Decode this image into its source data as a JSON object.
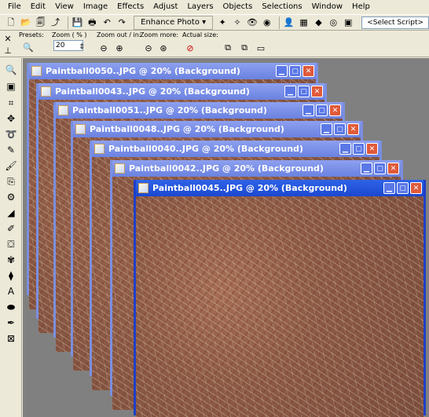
{
  "menubar": {
    "items": [
      "File",
      "Edit",
      "View",
      "Image",
      "Effects",
      "Adjust",
      "Layers",
      "Objects",
      "Selections",
      "Window",
      "Help"
    ]
  },
  "toolbar": {
    "enhance_photo_label": "Enhance Photo ▾",
    "script_select": "<Select Script>"
  },
  "tool_options": {
    "presets_label": "Presets:",
    "zoom_label": "Zoom ( % )",
    "zoom_value": "20",
    "zoom_out_in_label": "Zoom out / in:",
    "zoom_more_label": "Zoom more:",
    "actual_size_label": "Actual size:"
  },
  "documents": [
    {
      "title": "Paintball0050..JPG @  20% (Background)"
    },
    {
      "title": "Paintball0043..JPG @  20% (Background)"
    },
    {
      "title": "Paintball0051..JPG @  20% (Background)"
    },
    {
      "title": "Paintball0048..JPG @  20% (Background)"
    },
    {
      "title": "Paintball0040..JPG @  20% (Background)"
    },
    {
      "title": "Paintball0042..JPG @  20% (Background)"
    },
    {
      "title": "Paintball0045..JPG @  20% (Background)"
    }
  ],
  "active_document_index": 6,
  "colors": {
    "active_title": "#1b48d0",
    "inactive_title": "#7b8fe0",
    "workspace": "#808080"
  }
}
